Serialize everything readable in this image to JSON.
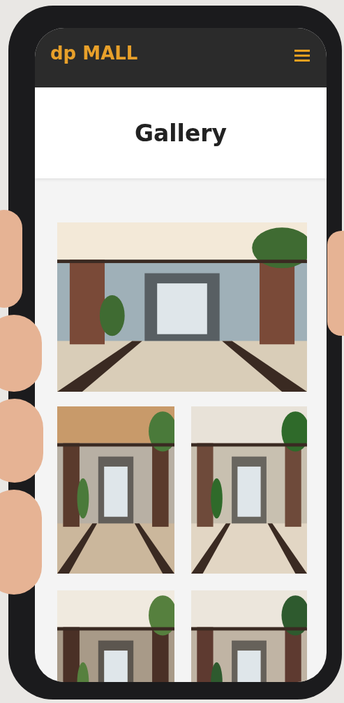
{
  "header": {
    "logo": "dp MALL"
  },
  "page": {
    "title": "Gallery"
  }
}
